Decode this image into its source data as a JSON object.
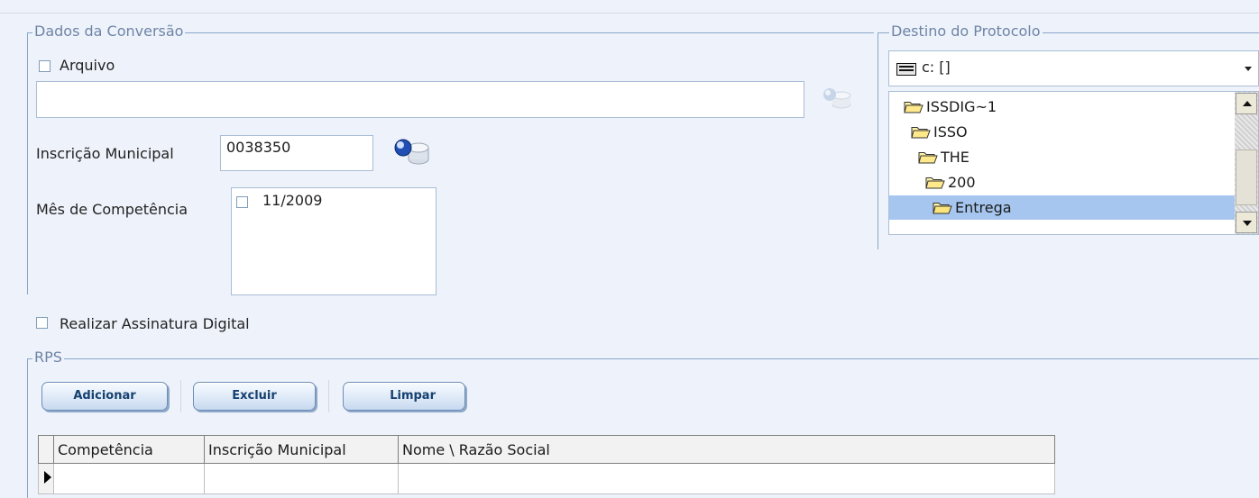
{
  "conversion": {
    "legend": "Dados da Conversão",
    "arquivo_label": "Arquivo",
    "arquivo_value": "",
    "inscricao_label": "Inscrição Municipal",
    "inscricao_value": "0038350",
    "mes_label": "Mês de Competência",
    "mes_items": [
      {
        "label": "11/2009",
        "checked": false
      }
    ]
  },
  "assinatura_label": "Realizar Assinatura Digital",
  "destination": {
    "legend": "Destino do Protocolo",
    "drive": "c: []",
    "folders": [
      {
        "label": "ISSDIG~1",
        "level": 0
      },
      {
        "label": "ISSO",
        "level": 1
      },
      {
        "label": "THE",
        "level": 2
      },
      {
        "label": "200",
        "level": 3
      },
      {
        "label": "Entrega",
        "level": 4,
        "selected": true
      }
    ]
  },
  "rps": {
    "legend": "RPS",
    "buttons": {
      "add": "Adicionar",
      "delete": "Excluir",
      "clear": "Limpar"
    },
    "columns": [
      "Competência",
      "Inscrição Municipal",
      "Nome \\ Razão Social"
    ]
  },
  "colors": {
    "background": "#eef3fb",
    "selection": "#a6c6ef",
    "legend_text": "#6e84a6",
    "button_text": "#15406f"
  },
  "icons": {
    "file_lookup": "search-database-icon-disabled",
    "inscricao_lookup": "search-database-icon",
    "drive": "drive-icon",
    "folder": "folder-icon"
  }
}
